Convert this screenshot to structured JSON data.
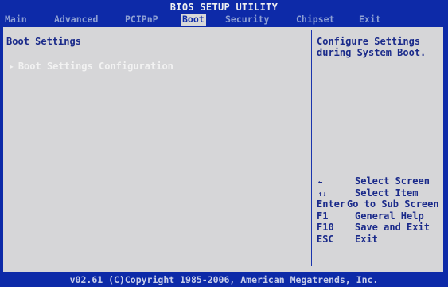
{
  "title": "BIOS SETUP UTILITY",
  "menu": [
    {
      "label": "Main",
      "active": false
    },
    {
      "label": "Advanced",
      "active": false
    },
    {
      "label": "PCIPnP",
      "active": false
    },
    {
      "label": "Boot",
      "active": true
    },
    {
      "label": "Security",
      "active": false
    },
    {
      "label": "Chipset",
      "active": false
    },
    {
      "label": "Exit",
      "active": false
    }
  ],
  "main": {
    "section_title": "Boot Settings",
    "entries": [
      {
        "label": "Boot Settings Configuration"
      }
    ]
  },
  "help": {
    "text": "Configure Settings during System Boot."
  },
  "keys": [
    {
      "key": "←",
      "desc": "Select Screen"
    },
    {
      "key": "↑↓",
      "desc": "Select Item"
    },
    {
      "key": "Enter",
      "desc": "Go to Sub Screen"
    },
    {
      "key": "F1",
      "desc": "General Help"
    },
    {
      "key": "F10",
      "desc": "Save and Exit"
    },
    {
      "key": "ESC",
      "desc": "Exit"
    }
  ],
  "footer": "v02.61 (C)Copyright 1985-2006, American Megatrends, Inc.",
  "colors": {
    "background": "#0d2aa8",
    "panel": "#d6d6d8",
    "text_dark": "#1a2a8a",
    "text_light": "#f2f2f2",
    "menu_inactive": "#8ea0d4"
  }
}
